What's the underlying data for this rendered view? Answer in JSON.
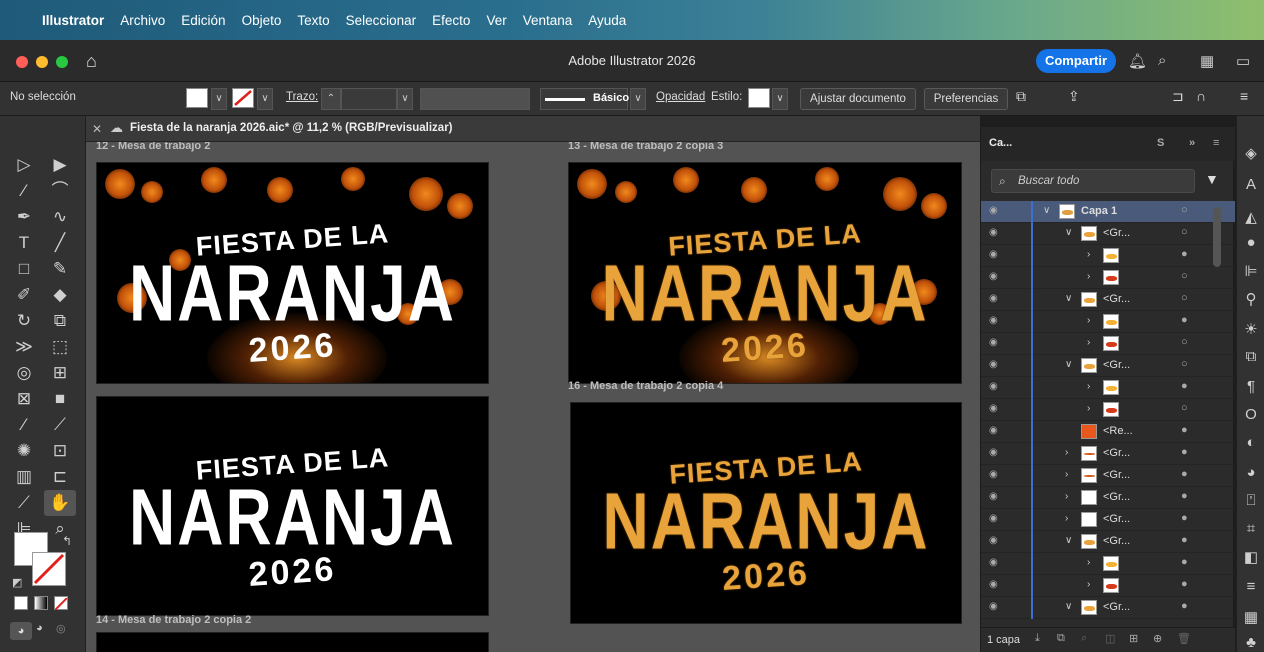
{
  "menubar": {
    "items": [
      "Illustrator",
      "Archivo",
      "Edición",
      "Objeto",
      "Texto",
      "Seleccionar",
      "Efecto",
      "Ver",
      "Ventana",
      "Ayuda"
    ]
  },
  "titlebar": {
    "title": "Adobe Illustrator 2026",
    "share_label": "Compartir"
  },
  "control": {
    "selection": "No selección",
    "stroke_label": "Trazo:",
    "brush_label": "Básico",
    "opacity_label": "Opacidad",
    "style_label": "Estilo:",
    "adjust_doc": "Ajustar documento",
    "prefs": "Preferencias"
  },
  "document": {
    "tab_title": "Fiesta de la naranja 2026.aic* @ 11,2 % (RGB/Previsualizar)"
  },
  "artboards": {
    "ab12": "12 - Mesa de trabajo 2",
    "ab13": "13 - Mesa de trabajo 2 copia 3",
    "ab16": "16 - Mesa de trabajo 2 copia 4",
    "ab14": "14 - Mesa de trabajo 2 copia 2"
  },
  "poster": {
    "line1": "FIESTA DE LA",
    "line2": "NARANJA",
    "line3": "2026"
  },
  "layers": {
    "tabs": [
      "Ca...",
      "S"
    ],
    "search_placeholder": "Buscar todo",
    "rows": [
      {
        "label": "Capa 1",
        "indent": 0,
        "arrow": "∨",
        "kind": "layer"
      },
      {
        "label": "<Gr...",
        "indent": 1,
        "arrow": "∨",
        "kind": "group"
      },
      {
        "label": "",
        "indent": 2,
        "arrow": "›",
        "kind": "yellow"
      },
      {
        "label": "",
        "indent": 2,
        "arrow": "›",
        "kind": "red"
      },
      {
        "label": "<Gr...",
        "indent": 1,
        "arrow": "∨",
        "kind": "group"
      },
      {
        "label": "",
        "indent": 2,
        "arrow": "›",
        "kind": "yellow"
      },
      {
        "label": "",
        "indent": 2,
        "arrow": "›",
        "kind": "red"
      },
      {
        "label": "<Gr...",
        "indent": 1,
        "arrow": "∨",
        "kind": "group"
      },
      {
        "label": "",
        "indent": 2,
        "arrow": "›",
        "kind": "yellow"
      },
      {
        "label": "",
        "indent": 2,
        "arrow": "›",
        "kind": "red"
      },
      {
        "label": "<Re...",
        "indent": 1,
        "arrow": "",
        "kind": "rect"
      },
      {
        "label": "<Gr...",
        "indent": 1,
        "arrow": "›",
        "kind": "line"
      },
      {
        "label": "<Gr...",
        "indent": 1,
        "arrow": "›",
        "kind": "line"
      },
      {
        "label": "<Gr...",
        "indent": 1,
        "arrow": "›",
        "kind": "blank"
      },
      {
        "label": "<Gr...",
        "indent": 1,
        "arrow": "›",
        "kind": "blank"
      },
      {
        "label": "<Gr...",
        "indent": 1,
        "arrow": "∨",
        "kind": "group"
      },
      {
        "label": "",
        "indent": 2,
        "arrow": "›",
        "kind": "yellow"
      },
      {
        "label": "",
        "indent": 2,
        "arrow": "›",
        "kind": "red"
      },
      {
        "label": "<Gr...",
        "indent": 1,
        "arrow": "∨",
        "kind": "group"
      }
    ],
    "footer": "1 capa"
  },
  "colors": {
    "accent": "#1473e6",
    "selected_row": "#4a5a7a",
    "layer_bar": "#3d6ecf",
    "gold": "#e8a33a"
  }
}
